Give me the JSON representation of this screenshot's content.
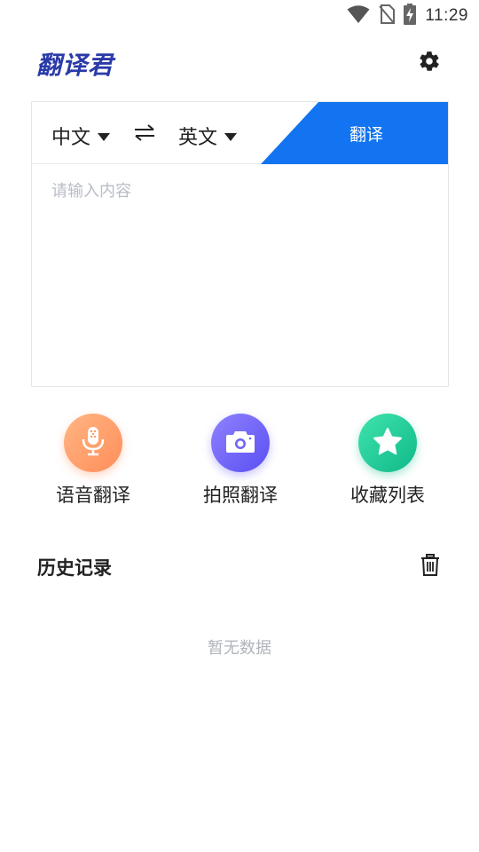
{
  "status_bar": {
    "time": "11:29",
    "icons": [
      "wifi-icon",
      "no-sim-icon",
      "battery-charging-icon"
    ]
  },
  "header": {
    "logo_text": "翻译君",
    "settings_icon": "gear-icon"
  },
  "translator": {
    "source_language": "中文",
    "target_language": "英文",
    "swap_icon": "swap-arrows-icon",
    "translate_button": "翻译",
    "input_placeholder": "请输入内容",
    "accent_color": "#1274f0"
  },
  "features": [
    {
      "label": "语音翻译",
      "icon": "microphone-icon",
      "color": "#ff9a66"
    },
    {
      "label": "拍照翻译",
      "icon": "camera-icon",
      "color": "#6e62f8"
    },
    {
      "label": "收藏列表",
      "icon": "star-icon",
      "color": "#22cc98"
    }
  ],
  "history": {
    "title": "历史记录",
    "clear_icon": "trash-icon",
    "empty_text": "暂无数据"
  }
}
